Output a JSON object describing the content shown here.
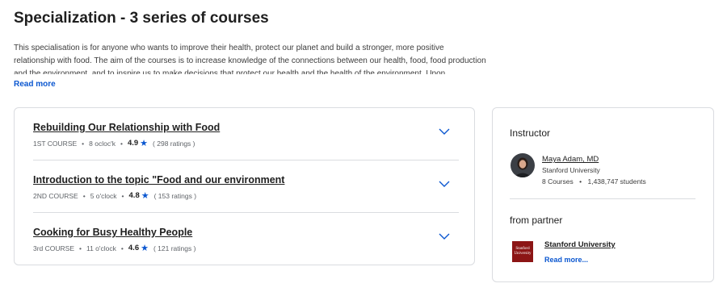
{
  "header": {
    "title": "Specialization - 3 series of courses"
  },
  "description": {
    "lines": [
      "This specialisation is for anyone who wants to improve their health, protect our planet and build a stronger, more positive",
      "relationship with food. The aim of the courses is to increase knowledge of the connections between our health, food, food production",
      "and the environment, and to inspire us to make decisions that protect our health and the health of the environment. Upon"
    ],
    "read_more": "Read more"
  },
  "courses": [
    {
      "title": "Rebuilding Our Relationship with Food",
      "label": "1ST COURSE",
      "duration": "8 ocloc'k",
      "rating": "4.9",
      "ratings_count": "( 298 ratings )"
    },
    {
      "title": "Introduction to the topic \"Food and our environment",
      "label": "2ND COURSE",
      "duration": "5 o'clock",
      "rating": "4.8",
      "ratings_count": "( 153 ratings )"
    },
    {
      "title": "Cooking for Busy Healthy People",
      "label": "3rd COURSE",
      "duration": "11 o'clock",
      "rating": "4.6",
      "ratings_count": "( 121 ratings )"
    }
  ],
  "meta_separator": "•",
  "instructor": {
    "heading": "Instructor",
    "name": "Maya Adam, MD",
    "organization": "Stanford University",
    "courses": "8 Courses",
    "students": "1,438,747 students"
  },
  "partner": {
    "heading": "from partner",
    "name": "Stanford University",
    "logo_text": "Stanford University",
    "read_more": "Read more..."
  },
  "icons": {
    "star": "star-icon",
    "chevron": "chevron-down-icon"
  },
  "colors": {
    "accent": "#0b57d0",
    "stanford_red": "#8c1515"
  }
}
